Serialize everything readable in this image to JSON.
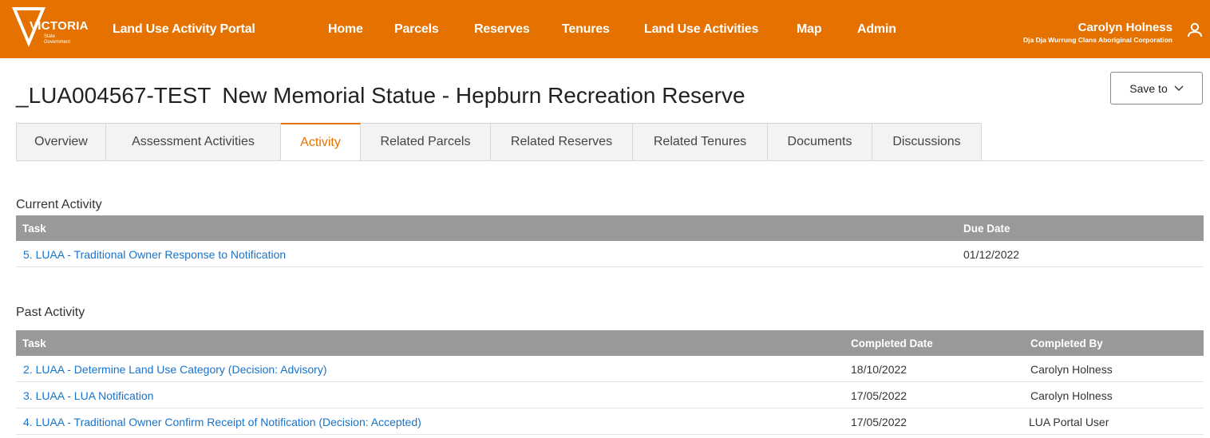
{
  "header": {
    "logo": {
      "word": "VICTORIA",
      "sub_line1": "State",
      "sub_line2": "Government"
    },
    "portal_title": "Land Use Activity Portal",
    "nav": [
      "Home",
      "Parcels",
      "Reserves",
      "Tenures",
      "Land Use Activities",
      "Map",
      "Admin"
    ],
    "user": {
      "name": "Carolyn Holness",
      "organisation": "Dja Dja Wurrung Clans Aboriginal Corporation",
      "icon": "user-icon"
    }
  },
  "record": {
    "id": "_LUA004567-TEST",
    "title": "New Memorial Statue - Hepburn Recreation Reserve"
  },
  "save_button": {
    "label": "Save to",
    "icon": "chevron-down-icon"
  },
  "tabs": [
    {
      "label": "Overview",
      "active": false
    },
    {
      "label": "Assessment Activities",
      "active": false
    },
    {
      "label": "Activity",
      "active": true
    },
    {
      "label": "Related Parcels",
      "active": false
    },
    {
      "label": "Related Reserves",
      "active": false
    },
    {
      "label": "Related Tenures",
      "active": false
    },
    {
      "label": "Documents",
      "active": false
    },
    {
      "label": "Discussions",
      "active": false
    }
  ],
  "current_activity": {
    "heading": "Current Activity",
    "columns": [
      "Task",
      "Due Date"
    ],
    "rows": [
      {
        "task": "5. LUAA - Traditional Owner Response to Notification",
        "due_date": "01/12/2022"
      }
    ]
  },
  "past_activity": {
    "heading": "Past Activity",
    "columns": [
      "Task",
      "Completed Date",
      "Completed By"
    ],
    "rows": [
      {
        "task": "2. LUAA - Determine Land Use Category (Decision: Advisory)",
        "completed_date": "18/10/2022",
        "completed_by": "Carolyn Holness"
      },
      {
        "task": "3. LUAA - LUA Notification",
        "completed_date": "17/05/2022",
        "completed_by": "Carolyn Holness"
      },
      {
        "task": "4. LUAA - Traditional Owner Confirm Receipt of Notification (Decision: Accepted)",
        "completed_date": "17/05/2022",
        "completed_by": "LUA Portal User"
      }
    ]
  },
  "colors": {
    "brand_orange": "#e57200",
    "table_header": "#999999",
    "link_blue": "#1a73c9"
  }
}
